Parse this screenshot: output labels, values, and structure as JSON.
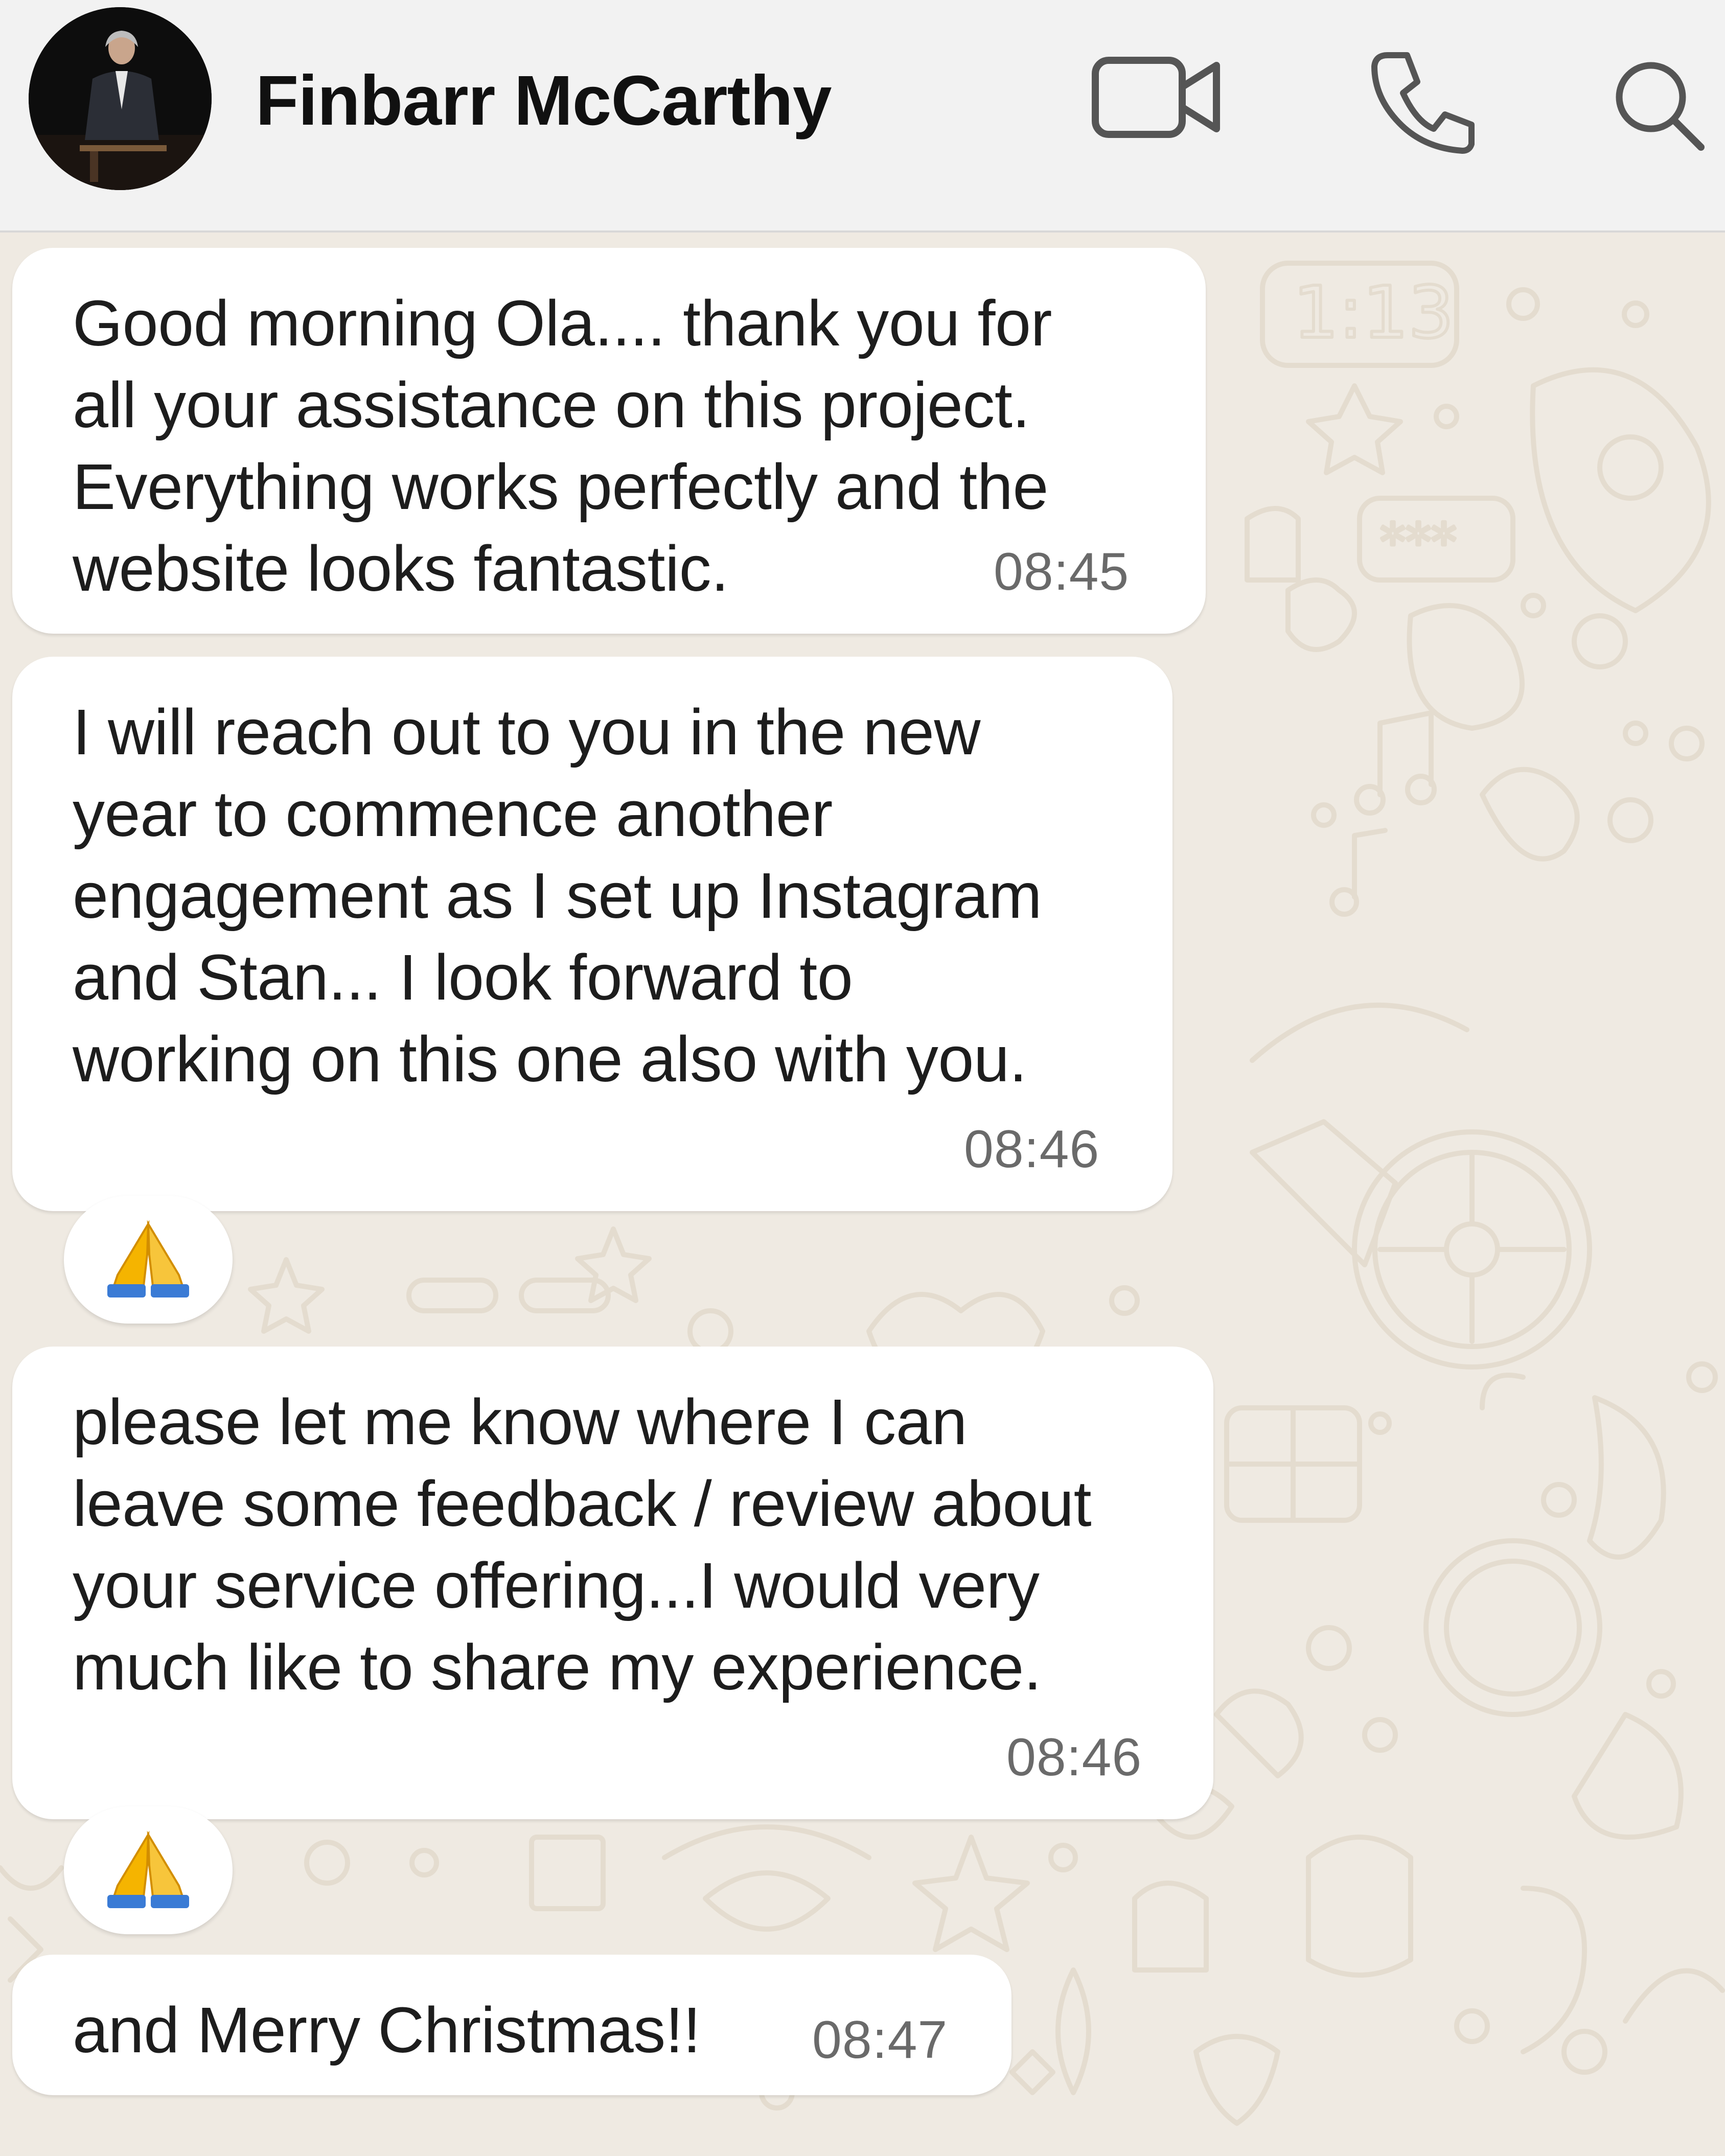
{
  "header": {
    "contact_name": "Finbarr McCarthy"
  },
  "icons": {
    "video": "video-camera-icon",
    "phone": "phone-icon",
    "search": "search-icon"
  },
  "messages": [
    {
      "text": "Good morning Ola.... thank you for\nall your assistance on this project.\nEverything works perfectly and the\nwebsite looks fantastic.",
      "time": "08:45"
    },
    {
      "text": "I will reach out to you in the new\nyear to commence another\nengagement as I set up Instagram\nand Stan... I look forward to\nworking on this one also with you.",
      "time": "08:46",
      "reaction": "🙏"
    },
    {
      "text": "please let me know where I can\nleave some feedback / review about\nyour service offering...I would very\nmuch like to share my experience.",
      "time": "08:46",
      "reaction": "🙏"
    },
    {
      "text": "and Merry Christmas!!",
      "time": "08:47"
    }
  ],
  "colors": {
    "header_bg": "#f2f2f2",
    "chat_bg": "#efeae2",
    "bubble_bg": "#ffffff",
    "time_color": "#6a6a6a",
    "reaction_color": "#f5b400"
  }
}
